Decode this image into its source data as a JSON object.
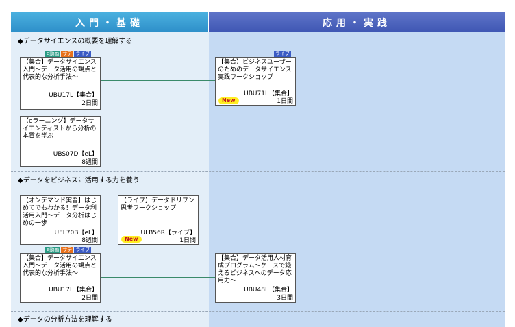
{
  "header": {
    "basic_label": "入門・基礎",
    "advanced_label": "応用・実践"
  },
  "colors": {
    "basic_header": "#3a9fd6",
    "advanced_header": "#4d66bf",
    "basic_bg": "#e3eef8",
    "advanced_bg": "#c5daf3",
    "badge_elearning": "#2a9b84",
    "badge_sachi": "#e8701a",
    "badge_live": "#3b5bc4",
    "new_badge": "#ffee22",
    "connector": "#3a8a6a"
  },
  "sections": [
    {
      "title": "◆データサイエンスの概要を理解する",
      "courses": [
        {
          "badges": [
            "e動画",
            "サテ",
            "ライブ"
          ],
          "title": "【集合】データサイエンス入門～データ活用の観点と代表的な分析手法～",
          "code": "UBU17L【集合】",
          "duration": "2日間",
          "is_new": false
        },
        {
          "badges": [],
          "title": "【eラーニング】データサイエンティストから分析の本質を学ぶ",
          "code": "UBS07D【eL】",
          "duration": "8週間",
          "is_new": false
        },
        {
          "badges": [
            "ライブ"
          ],
          "title": "【集合】ビジネスユーザーのためのデータサイエンス実践ワークショップ",
          "code": "UBU71L【集合】",
          "duration": "1日間",
          "is_new": true,
          "new_label": "New"
        }
      ]
    },
    {
      "title": "◆データをビジネスに活用する力を養う",
      "courses": [
        {
          "badges": [],
          "title": "【オンデマンド実習】はじめてでもわかる！データ利活用入門～データ分析はじめの一歩",
          "code": "UEL70B【eL】",
          "duration": "8週間",
          "is_new": false
        },
        {
          "badges": [],
          "title": "【ライブ】データドリブン思考ワークショップ",
          "code": "ULB56R【ライブ】",
          "duration": "1日間",
          "is_new": true,
          "new_label": "New"
        },
        {
          "badges": [
            "e動画",
            "サテ",
            "ライブ"
          ],
          "title": "【集合】データサイエンス入門～データ活用の観点と代表的な分析手法～",
          "code": "UBU17L【集合】",
          "duration": "2日間",
          "is_new": false
        },
        {
          "badges": [],
          "title": "【集合】データ活用人材育成プログラム～ケースで鍛えるビジネスへのデータ応用力～",
          "code": "UBU48L【集合】",
          "duration": "3日間",
          "is_new": false
        }
      ]
    },
    {
      "title": "◆データの分析方法を理解する",
      "courses": []
    }
  ]
}
